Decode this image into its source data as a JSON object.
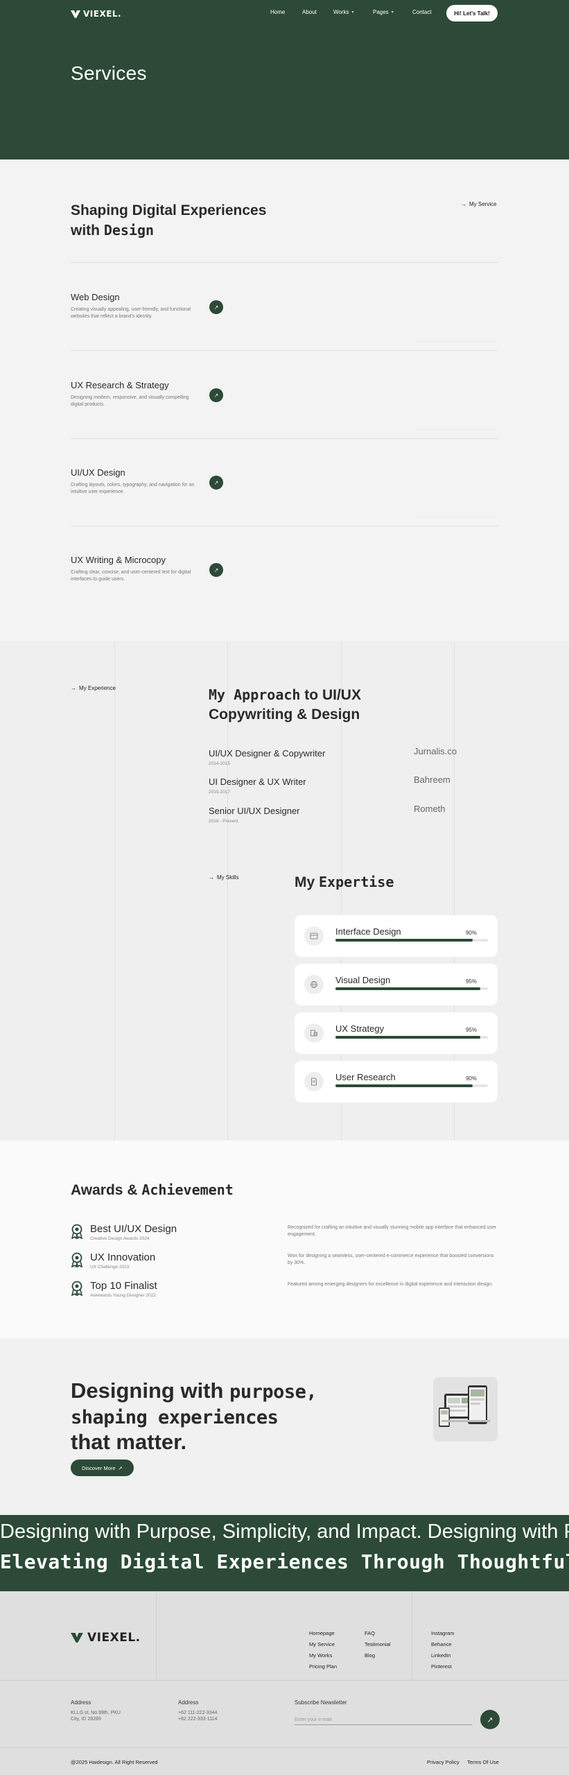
{
  "brand": {
    "name": "VIEXEL."
  },
  "nav": {
    "items": [
      {
        "label": "Home",
        "has_dropdown": false
      },
      {
        "label": "About",
        "has_dropdown": false
      },
      {
        "label": "Works",
        "has_dropdown": true
      },
      {
        "label": "Pages",
        "has_dropdown": true
      },
      {
        "label": "Contact",
        "has_dropdown": false
      }
    ],
    "cta": "Hi! Let's Talk!"
  },
  "hero": {
    "title": "Services"
  },
  "services": {
    "heading_plain": "Shaping Digital Experiences with ",
    "heading_bold": "Design",
    "tag": "My Service",
    "items": [
      {
        "title": "Web Design",
        "desc": "Creating visually appealing, user-friendly, and functional websites that reflect a brand's identity."
      },
      {
        "title": "UX Research & Strategy",
        "desc": "Designing modern, responsive, and visually compelling digital products."
      },
      {
        "title": "UI/UX Design",
        "desc": "Crafting layouts, colors, typography, and navigation for an intuitive user experience."
      },
      {
        "title": "UX Writing & Microcopy",
        "desc": "Crafting clear, concise, and user-centered text for digital interfaces to guide users."
      }
    ]
  },
  "experience": {
    "tag": "My Experience",
    "heading_bold": "My Approach",
    "heading_plain": " to UI/UX Copywriting & Design",
    "jobs": [
      {
        "title": "UI/UX Designer & Copywriter",
        "dates": "2014-2015",
        "company": "Jurnalis.co"
      },
      {
        "title": "UI Designer & UX Writer",
        "dates": "2015-2017",
        "company": "Bahreem"
      },
      {
        "title": "Senior UI/UX Designer",
        "dates": "2018 - Present",
        "company": "Rometh"
      }
    ]
  },
  "skills": {
    "tag": "My Skills",
    "heading_plain": "My ",
    "heading_bold": "Expertise",
    "items": [
      {
        "name": "Interface Design",
        "percent_label": "90%",
        "value": 90,
        "icon": "interface-icon"
      },
      {
        "name": "Visual Design",
        "percent_label": "95%",
        "value": 95,
        "icon": "globe-icon"
      },
      {
        "name": "UX Strategy",
        "percent_label": "95%",
        "value": 95,
        "icon": "strategy-icon"
      },
      {
        "name": "User Research",
        "percent_label": "90%",
        "value": 90,
        "icon": "document-icon"
      }
    ]
  },
  "awards": {
    "heading_plain": "Awards & ",
    "heading_bold": "Achievement",
    "items": [
      {
        "title": "Best UI/UX Design",
        "sub": "Creative Design Awards 2024",
        "desc": "Recognized for crafting an intuitive and visually stunning mobile app interface that enhanced user engagement."
      },
      {
        "title": "UX Innovation",
        "sub": "UX Challenge 2023",
        "desc": "Won for designing a seamless, user-centered e-commerce experience that boosted conversions by 30%."
      },
      {
        "title": "Top 10 Finalist",
        "sub": "Awwwards Young Designer 2022",
        "desc": "Featured among emerging designers for excellence in digital experience and interaction design."
      }
    ]
  },
  "cta_section": {
    "line1_plain": "Designing with ",
    "line1_bold": "purpose,",
    "line2_bold": "shaping experiences",
    "line3_plain": "that matter.",
    "button": "Discover More"
  },
  "marquee": {
    "line1": "Designing with Purpose, Simplicity, and Impact.  Designing with Purpose, Simplicity, and Impact.",
    "line2": "Elevating Digital Experiences Through Thoughtful Design"
  },
  "footer": {
    "links_col1": [
      "Homepage",
      "My Service",
      "My Works",
      "Pricing Plan"
    ],
    "links_col2": [
      "FAQ",
      "Testimonial",
      "Blog"
    ],
    "social": [
      "Instagram",
      "Behance",
      "LinkedIn",
      "Pinterest"
    ],
    "address1": {
      "label": "Address",
      "lines": [
        "KLLG st, No.99th, PKU",
        "City, ID 28289"
      ]
    },
    "address2": {
      "label": "Address",
      "lines": [
        "+62 111-222-3344",
        "+62 222-333-1114"
      ]
    },
    "newsletter": {
      "label": "Subscribe Newsletter",
      "placeholder": "Enter your e-mail"
    },
    "copyright": "@2025 Haidesign. All Right Reserved",
    "privacy": "Privacy Policy",
    "terms": "Terms Of Use"
  }
}
